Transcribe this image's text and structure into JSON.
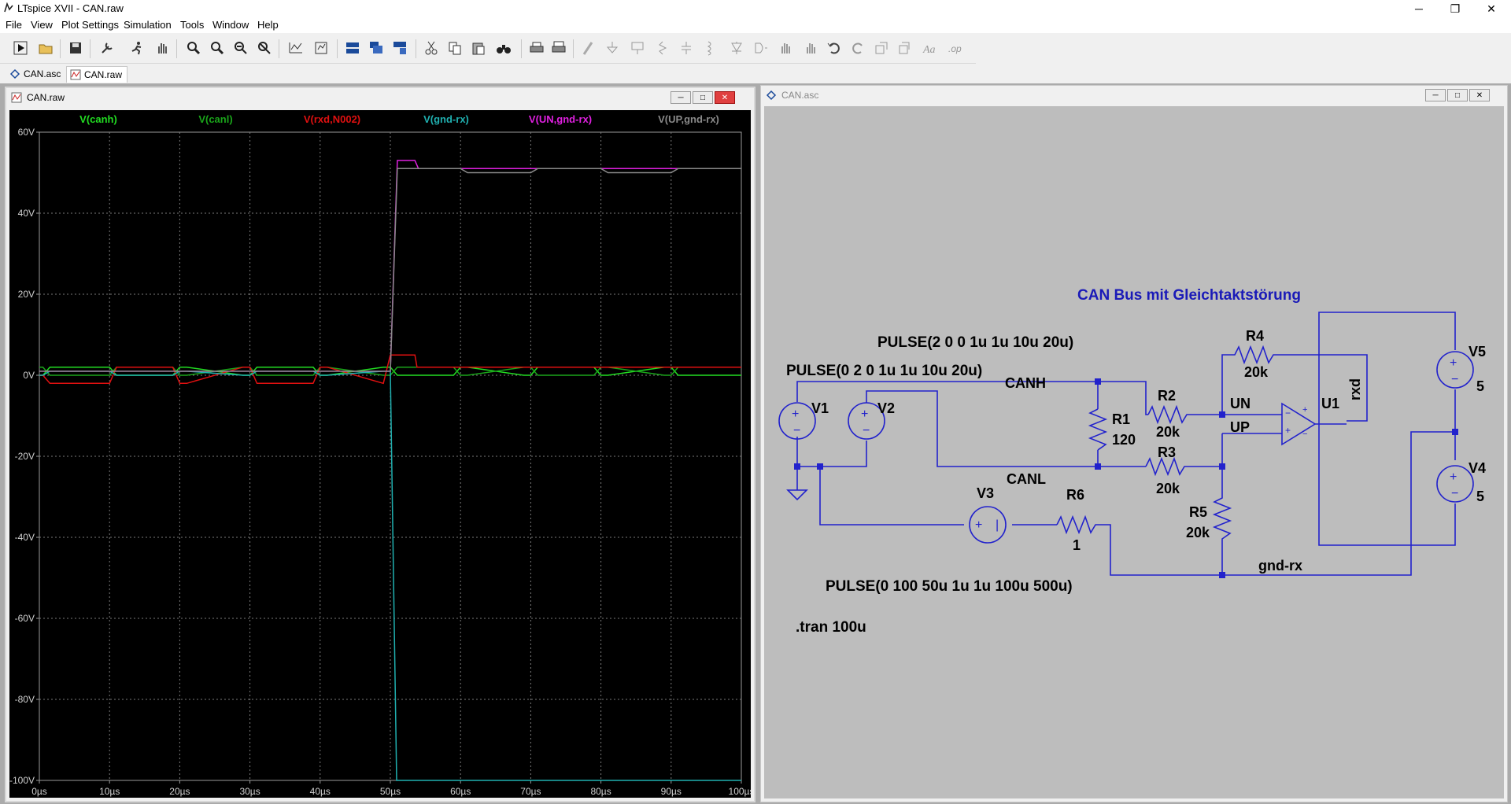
{
  "window": {
    "title": "LTspice XVII - CAN.raw",
    "minimize": "─",
    "maximize": "❐",
    "close": "✕"
  },
  "menu": [
    "File",
    "View",
    "Plot Settings",
    "Simulation",
    "Tools",
    "Window",
    "Help"
  ],
  "toolbar": {
    "icons": [
      "run-icon",
      "open-icon",
      "save-icon",
      "control-panel-icon",
      "halt-icon",
      "pan-icon",
      "zoom-in-icon",
      "zoom-area-icon",
      "zoom-out-icon",
      "zoom-full-icon",
      "autorange-icon",
      "manual-limits-icon",
      "tile-horizontal-icon",
      "cascade-icon",
      "tile-vertical-icon",
      "cut-icon",
      "copy-icon",
      "paste-icon",
      "find-icon",
      "print-icon",
      "print-preview-icon",
      "wire-icon",
      "ground-icon",
      "label-net-icon",
      "resistor-icon",
      "capacitor-icon",
      "inductor-icon",
      "diode-icon",
      "component-icon",
      "move-icon",
      "drag-icon",
      "undo-icon",
      "redo-icon",
      "rotate-icon",
      "mirror-icon",
      "text-icon",
      "spice-directive-icon"
    ]
  },
  "tabs": [
    {
      "label": "CAN.asc"
    },
    {
      "label": "CAN.raw"
    }
  ],
  "plot_window": {
    "title": "CAN.raw",
    "min": "─",
    "max": "□",
    "close": "✕"
  },
  "schematic_window": {
    "title": "CAN.asc",
    "min": "─",
    "max": "□",
    "close": "✕"
  },
  "chart_data": {
    "type": "line",
    "xlabel": "",
    "ylabel": "",
    "xlim": [
      0,
      100
    ],
    "ylim": [
      -100,
      60
    ],
    "x_unit": "µs",
    "y_unit": "V",
    "grid": true,
    "legend_position": "top",
    "x_ticks": [
      "0µs",
      "10µs",
      "20µs",
      "30µs",
      "40µs",
      "50µs",
      "60µs",
      "70µs",
      "80µs",
      "90µs",
      "100µs"
    ],
    "y_ticks": [
      "60V",
      "40V",
      "20V",
      "0V",
      "-20V",
      "-40V",
      "-60V",
      "-80V",
      "-100V"
    ],
    "y_tick_values": [
      60,
      40,
      20,
      0,
      -20,
      -40,
      -60,
      -80,
      -100
    ],
    "x_tick_values": [
      0,
      10,
      20,
      30,
      40,
      50,
      60,
      70,
      80,
      90,
      100
    ],
    "series": [
      {
        "name": "V(canh)",
        "color": "#22dd22",
        "x": [
          0,
          0.5,
          1.5,
          10,
          11,
          19,
          20,
          21,
          29,
          30,
          31,
          39,
          40,
          41,
          49,
          50,
          51,
          59,
          60,
          61,
          69,
          70,
          71,
          79,
          80,
          81,
          89,
          90,
          91,
          100
        ],
        "y": [
          0,
          0,
          2,
          2,
          0,
          0,
          2,
          2,
          0,
          0,
          2,
          2,
          0,
          0,
          2,
          2,
          0,
          0,
          2,
          2,
          0,
          0,
          2,
          2,
          0,
          0,
          2,
          2,
          0,
          0
        ]
      },
      {
        "name": "V(canl)",
        "color": "#1aa51a",
        "x": [
          0,
          0.5,
          1.5,
          10,
          11,
          19,
          20,
          21,
          29,
          30,
          31,
          39,
          40,
          41,
          49,
          50,
          51,
          59,
          60,
          61,
          69,
          70,
          71,
          79,
          80,
          81,
          89,
          90,
          91,
          100
        ],
        "y": [
          2,
          2,
          0,
          0,
          2,
          2,
          0,
          0,
          2,
          2,
          0,
          0,
          2,
          2,
          0,
          0,
          2,
          2,
          0,
          0,
          2,
          2,
          0,
          0,
          2,
          2,
          0,
          0,
          2,
          2
        ]
      },
      {
        "name": "V(rxd,N002)",
        "color": "#e01010",
        "x": [
          0,
          0.5,
          1.5,
          10,
          11,
          19,
          20,
          21,
          29,
          30,
          31,
          39,
          40,
          41,
          49,
          50,
          53.5,
          53.8,
          100
        ],
        "y": [
          0,
          0,
          -2,
          -2,
          2,
          2,
          -2,
          -2,
          2,
          2,
          -2,
          -2,
          2,
          2,
          -2,
          5,
          5,
          2,
          2
        ]
      },
      {
        "name": "V(gnd-rx)",
        "color": "#20b0b0",
        "x": [
          0,
          0.5,
          1.5,
          10,
          11,
          19,
          20,
          21,
          29,
          30,
          31,
          39,
          40,
          41,
          49,
          50,
          50.9,
          100
        ],
        "y": [
          0,
          0,
          1,
          1,
          0,
          0,
          1,
          1,
          0,
          0,
          1,
          1,
          0,
          0,
          1,
          1,
          -100,
          -100
        ]
      },
      {
        "name": "V(UN,gnd-rx)",
        "color": "#e020e0",
        "x": [
          0,
          50,
          51,
          52,
          53.5,
          54,
          100
        ],
        "y": [
          1,
          1,
          53,
          53,
          53,
          51,
          51
        ]
      },
      {
        "name": "V(UP,gnd-rx)",
        "color": "#8a8a8a",
        "x": [
          0,
          50,
          51,
          54,
          60,
          61,
          70,
          71,
          80,
          81,
          90,
          91,
          100
        ],
        "y": [
          1,
          1,
          51,
          51,
          51,
          50,
          50,
          51,
          51,
          50,
          50,
          51,
          51
        ]
      }
    ]
  },
  "schematic": {
    "title_text": "CAN Bus mit Gleichtaktstörung",
    "pulse_v2": "PULSE(2 0 0 1u 1u 10u 20u)",
    "pulse_v1": "PULSE(0 2 0 1u 1u 10u 20u)",
    "pulse_v3": "PULSE(0 100 50u 1u 1u 100u 500u)",
    "tran": ".tran 100u",
    "nets": {
      "canh": "CANH",
      "canl": "CANL",
      "un": "UN",
      "up": "UP",
      "rxd": "rxd",
      "gndrx": "gnd-rx"
    },
    "components": {
      "v1": "V1",
      "v2": "V2",
      "v3": "V3",
      "v4": "V4",
      "v5": "V5",
      "v4_val": "5",
      "v5_val": "5",
      "r1": "R1",
      "r1_val": "120",
      "r2": "R2",
      "r2_val": "20k",
      "r3": "R3",
      "r3_val": "20k",
      "r4": "R4",
      "r4_val": "20k",
      "r5": "R5",
      "r5_val": "20k",
      "r6": "R6",
      "r6_val": "1",
      "u1": "U1"
    }
  }
}
